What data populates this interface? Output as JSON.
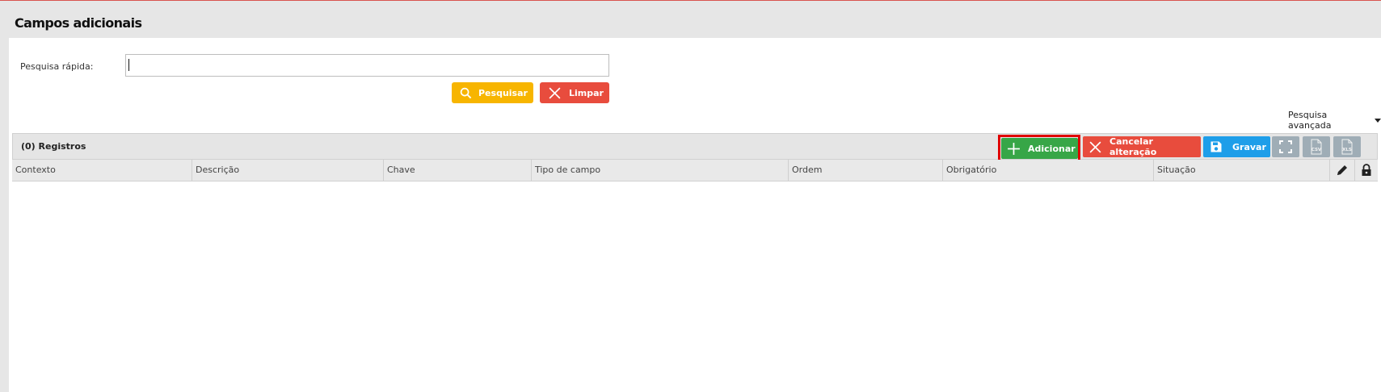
{
  "page": {
    "title": "Campos adicionais"
  },
  "search": {
    "label": "Pesquisa rápida:",
    "value": "",
    "search_button": "Pesquisar",
    "clear_button": "Limpar",
    "advanced_label": "Pesquisa avançada"
  },
  "grid": {
    "records_label": "(0) Registros",
    "toolbar": {
      "add": "Adicionar",
      "cancel": "Cancelar alteração",
      "save": "Gravar",
      "csv": "CSV",
      "xls": "XLS"
    },
    "columns": [
      "Contexto",
      "Descrição",
      "Chave",
      "Tipo de campo",
      "Ordem",
      "Obrigatório",
      "Situação"
    ],
    "rows": []
  },
  "colors": {
    "search": "#f7b500",
    "clear": "#e84c3d",
    "add": "#37a647",
    "save": "#1e9ee9",
    "highlight": "#e00000",
    "icon_buttons": "#9fadb6"
  },
  "icons": [
    "search-icon",
    "close-icon",
    "plus-icon",
    "floppy-disk-icon",
    "fullscreen-icon",
    "csv-file-icon",
    "xls-file-icon",
    "pencil-icon",
    "lock-icon",
    "caret-down-icon"
  ]
}
